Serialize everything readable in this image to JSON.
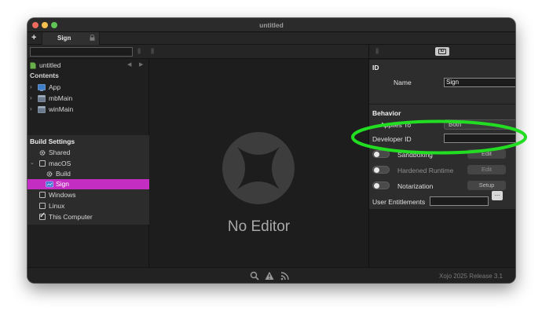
{
  "window": {
    "title": "untitled"
  },
  "tabs": {
    "add_label": "+",
    "items": [
      {
        "label": "Sign"
      }
    ]
  },
  "navigator": {
    "search": {
      "value": "",
      "placeholder": ""
    },
    "project": {
      "name": "untitled"
    },
    "contents_header": "Contents",
    "contents": [
      {
        "label": "App",
        "icon": "app-icon"
      },
      {
        "label": "mbMain",
        "icon": "window-icon"
      },
      {
        "label": "winMain",
        "icon": "window-icon"
      }
    ],
    "build_settings_header": "Build Settings",
    "build_items": [
      {
        "label": "Shared",
        "icon": "gear-icon"
      },
      {
        "label": "macOS",
        "checked": false,
        "expanded": true
      },
      {
        "label": "Build",
        "icon": "gear-icon"
      },
      {
        "label": "Sign",
        "icon": "sign-icon",
        "selected": true
      },
      {
        "label": "Windows",
        "checked": false
      },
      {
        "label": "Linux",
        "checked": false
      },
      {
        "label": "This Computer",
        "checked": true
      }
    ]
  },
  "editor": {
    "placeholder_text": "No Editor"
  },
  "inspector": {
    "id_section": "ID",
    "name_label": "Name",
    "name_value": "Sign",
    "behavior_section": "Behavior",
    "applies_to_label": "Applies To",
    "applies_to_value": "Both",
    "developer_id_label": "Developer ID",
    "developer_id_value": "",
    "sandboxing": {
      "label": "Sandboxing",
      "button": "Edit",
      "enabled": false
    },
    "hardened_runtime": {
      "label": "Hardened Runtime",
      "button": "Edit",
      "enabled": false
    },
    "notarization": {
      "label": "Notarization",
      "button": "Setup",
      "enabled": false
    },
    "user_entitlements": {
      "label": "User Entitlements",
      "value": "",
      "button": "..."
    }
  },
  "statusbar": {
    "release_text": "Xojo 2025 Release 3.1"
  },
  "colors": {
    "selection": "#c32dc1",
    "annotation": "#22dd22"
  }
}
